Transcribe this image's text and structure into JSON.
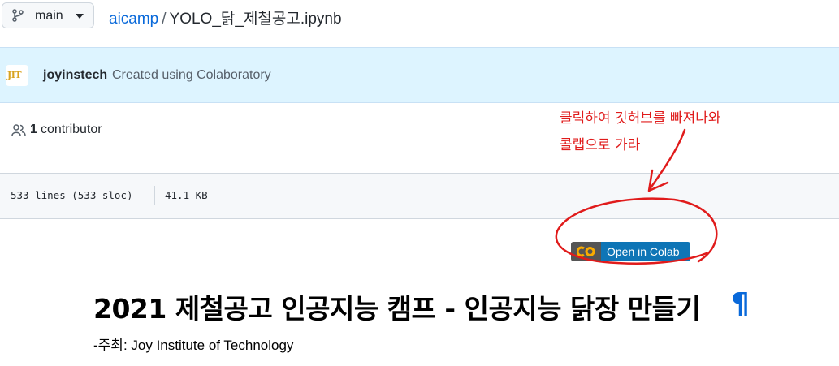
{
  "header": {
    "branch": "main",
    "repo": "aicamp",
    "separator": "/",
    "file": "YOLO_닭_제철공고.ipynb"
  },
  "commit": {
    "avatar_text": "JIT",
    "author": "joyinstech",
    "message": "Created using Colaboratory"
  },
  "contributors": {
    "count": "1",
    "label": "contributor"
  },
  "file_meta": {
    "lines": "533 lines (533 sloc)",
    "size": "41.1 KB"
  },
  "colab_badge": {
    "logo": "CO",
    "label": "Open in Colab"
  },
  "notebook": {
    "title": "2021 제철공고 인공지능 캠프 - 인공지능 닭장 만들기",
    "anchor": "¶",
    "subtitle": "-주최: Joy Institute of Technology"
  },
  "annotation": {
    "line1": "클릭하여 깃허브를 빠져나와",
    "line2": "콜랩으로 가라",
    "color": "#e01b1b"
  },
  "colors": {
    "link": "#0969da",
    "commit_bg": "#ddf4ff",
    "badge_blue": "#0e75b6",
    "badge_grey": "#555555",
    "colab_orange": "#f9ab00"
  }
}
